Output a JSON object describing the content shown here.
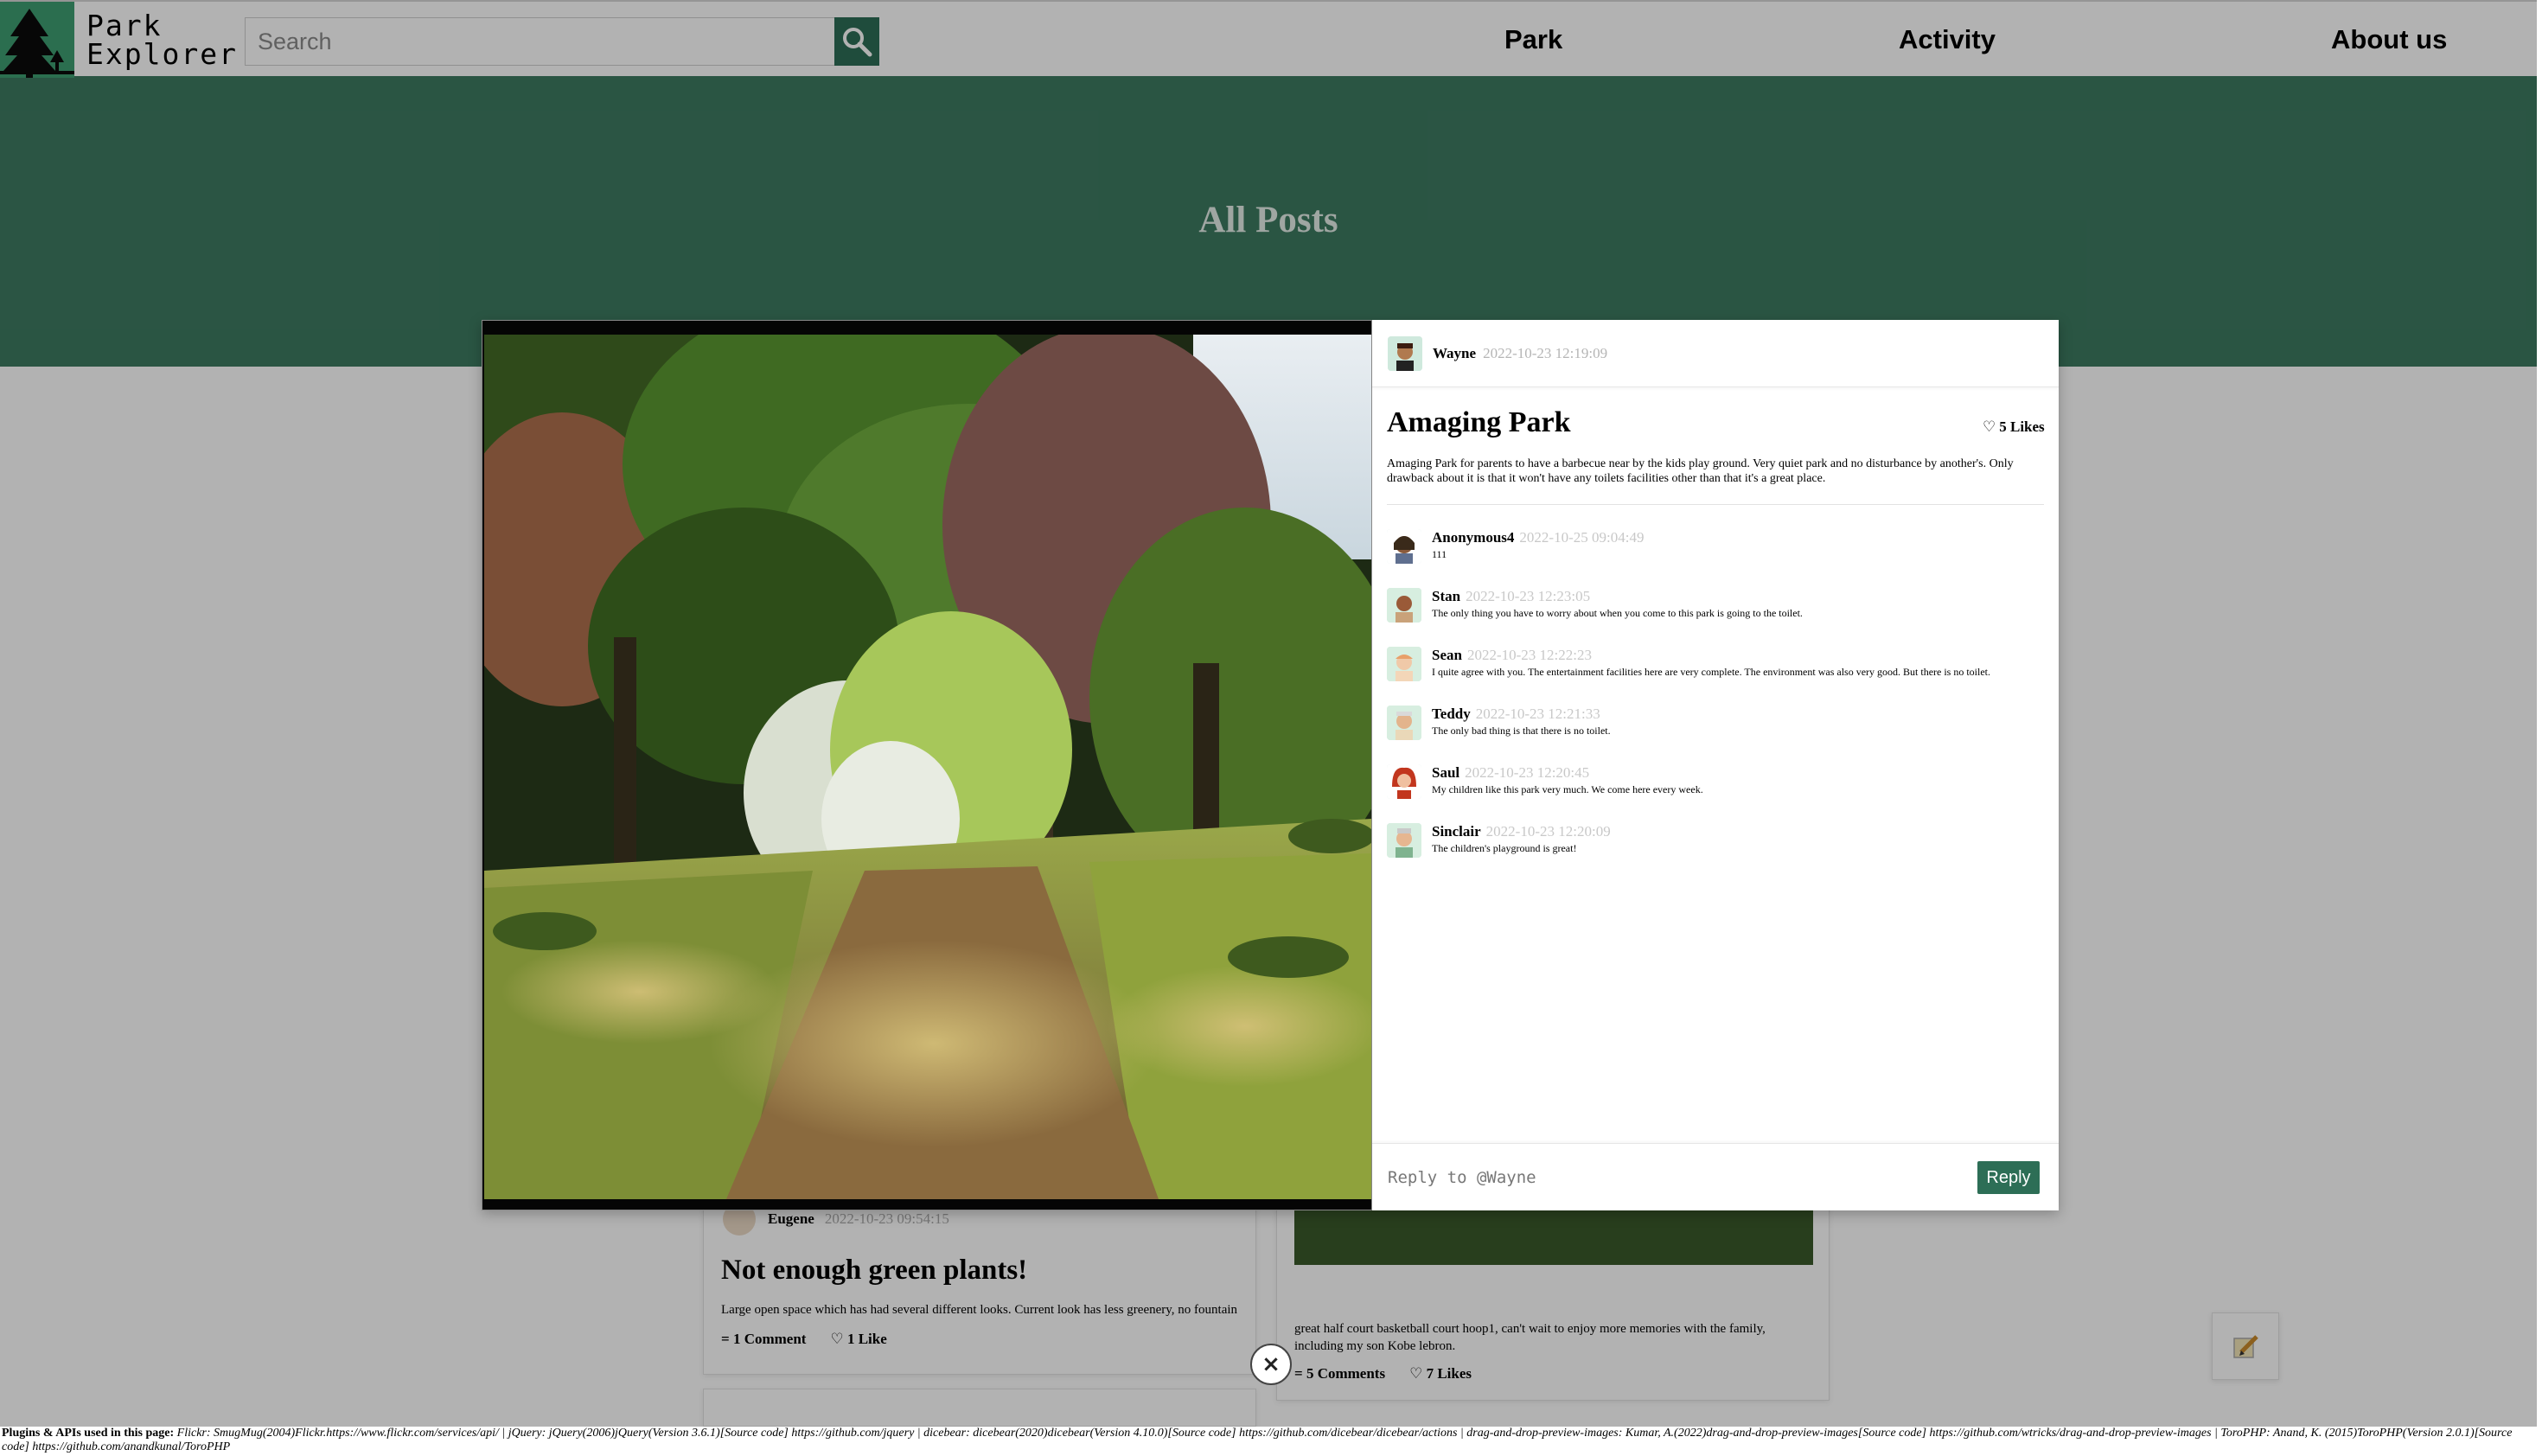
{
  "header": {
    "logo_line1": "Park",
    "logo_line2": "Explorer",
    "search_placeholder": "Search",
    "nav": [
      "Park",
      "Activity",
      "About us"
    ]
  },
  "hero": {
    "title": "All Posts"
  },
  "background_posts": [
    {
      "author": "Eugene",
      "timestamp": "2022-10-23 09:54:15",
      "title": "Not enough green plants!",
      "body": "Large open space which has had several different looks. Current look has less greenery, no fountain",
      "comments": "1 Comment",
      "likes": "1 Like"
    },
    {
      "body": "great half court basketball court hoop1, can't wait to enjoy more memories with the family, including my son Kobe lebron.",
      "comments": "5 Comments",
      "likes": "7 Likes"
    }
  ],
  "modal": {
    "author": "Wayne",
    "timestamp": "2022-10-23 12:19:09",
    "title": "Amaging Park",
    "likes": "5 Likes",
    "description": "Amaging Park for parents to have a barbecue near by the kids play ground. Very quiet park and no disturbance by another's. Only drawback about it is that it won't have any toilets facilities other than that it's a great place.",
    "comments": [
      {
        "author": "Anonymous4",
        "timestamp": "2022-10-25 09:04:49",
        "text": "111"
      },
      {
        "author": "Stan",
        "timestamp": "2022-10-23 12:23:05",
        "text": "The only thing you have to worry about when you come to this park is going to the toilet."
      },
      {
        "author": "Sean",
        "timestamp": "2022-10-23 12:22:23",
        "text": "I quite agree with you. The entertainment facilities here are very complete. The environment was also very good. But there is no toilet."
      },
      {
        "author": "Teddy",
        "timestamp": "2022-10-23 12:21:33",
        "text": "The only bad thing is that there is no toilet."
      },
      {
        "author": "Saul",
        "timestamp": "2022-10-23 12:20:45",
        "text": "My children like this park very much. We come here every week."
      },
      {
        "author": "Sinclair",
        "timestamp": "2022-10-23 12:20:09",
        "text": "The children's playground is great!"
      }
    ],
    "reply_placeholder": "Reply to @Wayne",
    "reply_button": "Reply",
    "close_symbol": "×"
  },
  "footer": {
    "label": "Plugins & APIs used in this page:",
    "text": " Flickr: SmugMug(2004)Flickr.https://www.flickr.com/services/api/ | jQuery: jQuery(2006)jQuery(Version 3.6.1)[Source code] https://github.com/jquery | dicebear: dicebear(2020)dicebear(Version 4.10.0)[Source code] https://github.com/dicebear/dicebear/actions | drag-and-drop-preview-images: Kumar, A.(2022)drag-and-drop-preview-images[Source code] https://github.com/wtricks/drag-and-drop-preview-images | ToroPHP: Anand, K. (2015)ToroPHP(Version 2.0.1)[Source code] https://github.com/anandkunal/ToroPHP"
  },
  "colors": {
    "brand_green": "#3e9e72",
    "dark_green": "#2d6e56",
    "hero_green": "#3d7a61"
  }
}
